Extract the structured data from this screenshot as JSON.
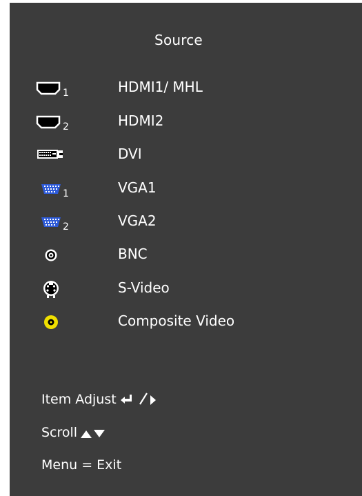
{
  "menu": {
    "title": "Source"
  },
  "sources": [
    {
      "icon": "hdmi-icon",
      "index": "1",
      "label": "HDMI1/ MHL"
    },
    {
      "icon": "hdmi-icon",
      "index": "2",
      "label": "HDMI2"
    },
    {
      "icon": "dvi-icon",
      "index": "",
      "label": "DVI"
    },
    {
      "icon": "vga-icon",
      "index": "1",
      "label": "VGA1"
    },
    {
      "icon": "vga-icon",
      "index": "2",
      "label": "VGA2"
    },
    {
      "icon": "bnc-icon",
      "index": "",
      "label": "BNC"
    },
    {
      "icon": "s-video-icon",
      "index": "",
      "label": "S-Video"
    },
    {
      "icon": "composite-video-icon",
      "index": "",
      "label": "Composite Video"
    }
  ],
  "help": {
    "item_adjust": "Item Adjust",
    "scroll": "Scroll",
    "menu_exit": "Menu = Exit"
  },
  "colors": {
    "panel_background": "#3c3c3c",
    "text": "#ffffff",
    "vga_blue": "#2e5bd8",
    "composite_yellow": "#f0e000"
  }
}
